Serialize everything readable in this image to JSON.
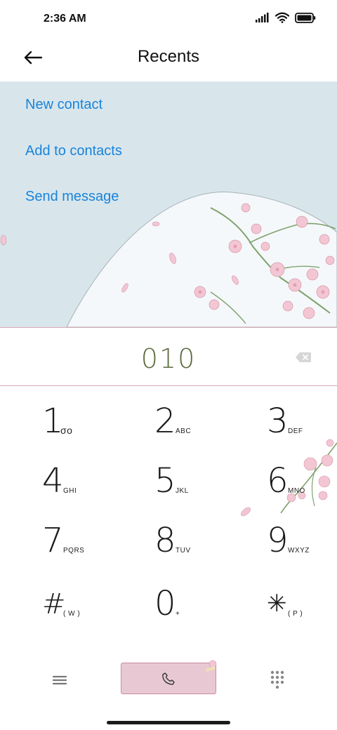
{
  "status_bar": {
    "time": "2:36 AM",
    "icons": [
      "signal-icon",
      "wifi-icon",
      "battery-icon"
    ]
  },
  "header": {
    "title": "Recents",
    "back_icon": "arrow-left-icon"
  },
  "actions": [
    {
      "label": "New contact"
    },
    {
      "label": "Add to contacts"
    },
    {
      "label": "Send message"
    }
  ],
  "dialed_number": "010",
  "keypad": [
    {
      "digit": "1",
      "letters": "σο"
    },
    {
      "digit": "2",
      "letters": "ABC"
    },
    {
      "digit": "3",
      "letters": "DEF"
    },
    {
      "digit": "4",
      "letters": "GHI"
    },
    {
      "digit": "5",
      "letters": "JKL"
    },
    {
      "digit": "6",
      "letters": "MNO"
    },
    {
      "digit": "7",
      "letters": "PQRS"
    },
    {
      "digit": "8",
      "letters": "TUV"
    },
    {
      "digit": "9",
      "letters": "WXYZ"
    },
    {
      "digit": "#",
      "letters": "( W )"
    },
    {
      "digit": "0",
      "letters": "+"
    },
    {
      "digit": "✳",
      "letters": "( P )"
    }
  ],
  "bottom_bar": {
    "menu_icon": "hamburger-menu-icon",
    "call_icon": "phone-icon",
    "dialpad_icon": "dialpad-grid-icon"
  },
  "colors": {
    "link": "#1a83d9",
    "panel_bg": "#d8e6ec",
    "number": "#5b6b3c",
    "call_button": "#e8c9d3",
    "divider": "#d9a7b0"
  }
}
